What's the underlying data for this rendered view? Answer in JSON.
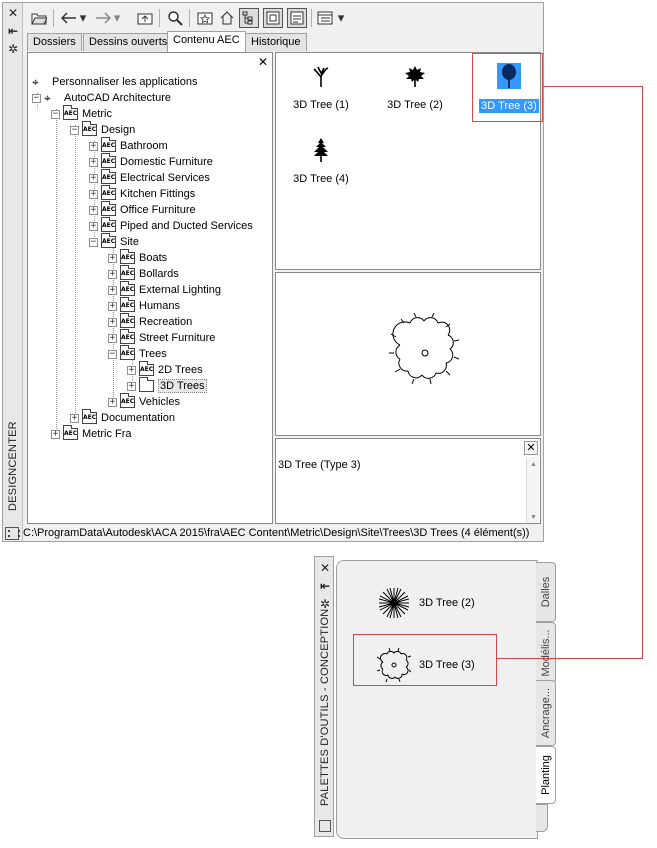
{
  "design_center": {
    "title": "DESIGNCENTER",
    "tabs": [
      {
        "label": "Dossiers",
        "active": false
      },
      {
        "label": "Dessins ouverts",
        "active": false
      },
      {
        "label": "Contenu AEC",
        "active": true
      },
      {
        "label": "Historique",
        "active": false
      }
    ],
    "tree": {
      "personalize": "Personnaliser les applications",
      "aca": "AutoCAD Architecture",
      "metric": "Metric",
      "design": "Design",
      "bathroom": "Bathroom",
      "domestic": "Domestic Furniture",
      "electrical": "Electrical Services",
      "kitchen": "Kitchen Fittings",
      "office": "Office Furniture",
      "piped": "Piped and Ducted Services",
      "site": "Site",
      "boats": "Boats",
      "bollards": "Bollards",
      "external": "External Lighting",
      "humans": "Humans",
      "recreation": "Recreation",
      "street": "Street Furniture",
      "trees": "Trees",
      "trees2d": "2D Trees",
      "trees3d": "3D Trees",
      "vehicles": "Vehicles",
      "documentation": "Documentation",
      "metric_fra": "Metric Fra"
    },
    "content_items": [
      {
        "label": "3D Tree (1)",
        "icon": "tree-1-icon",
        "selected": false
      },
      {
        "label": "3D Tree (2)",
        "icon": "tree-2-icon",
        "selected": false
      },
      {
        "label": "3D Tree (3)",
        "icon": "tree-3-icon",
        "selected": true
      },
      {
        "label": "3D Tree (4)",
        "icon": "tree-4-icon",
        "selected": false
      }
    ],
    "description": "3D Tree (Type 3)",
    "status_path": "C:\\ProgramData\\Autodesk\\ACA 2015\\fra\\AEC Content\\Metric\\Design\\Site\\Trees\\3D Trees (4 élément(s))"
  },
  "tool_palettes": {
    "title": "PALETTES D'OUTILS - CONCEPTION",
    "tabs": [
      "Dalles",
      "Modélis...",
      "Ancrage...",
      "Planting"
    ],
    "active_tab": "Planting",
    "items": [
      {
        "label": "3D Tree (2)",
        "icon": "starburst-tree-icon"
      },
      {
        "label": "3D Tree (3)",
        "icon": "circle-tree-icon"
      }
    ]
  },
  "colors": {
    "callout": "#d9464b",
    "selection": "#3399ff"
  }
}
